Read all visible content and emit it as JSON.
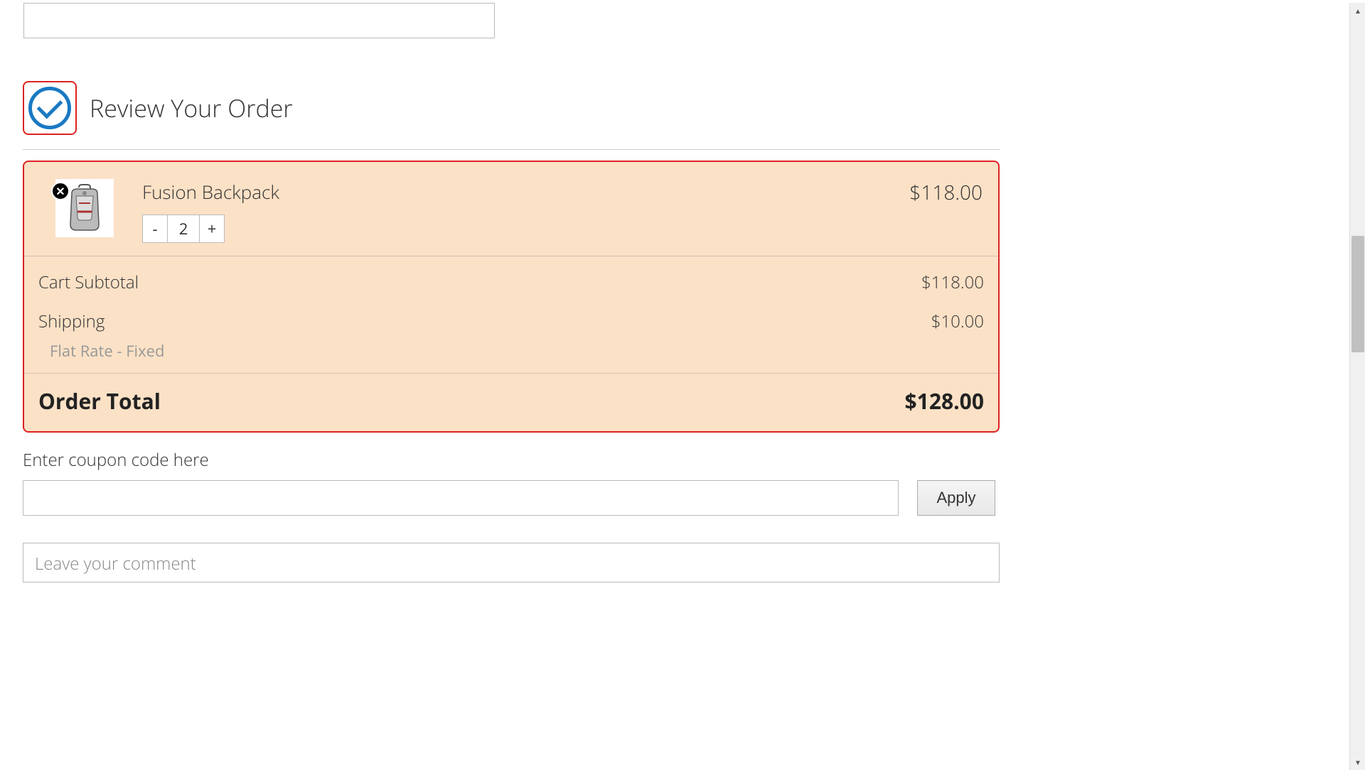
{
  "review": {
    "title": "Review Your Order",
    "item": {
      "name": "Fusion Backpack",
      "quantity": "2",
      "price": "$118.00",
      "decrement": "-",
      "increment": "+"
    },
    "subtotal": {
      "label": "Cart Subtotal",
      "value": "$118.00"
    },
    "shipping": {
      "label": "Shipping",
      "value": "$10.00",
      "method": "Flat Rate - Fixed"
    },
    "total": {
      "label": "Order Total",
      "value": "$128.00"
    }
  },
  "coupon": {
    "label": "Enter coupon code here",
    "apply": "Apply"
  },
  "comment": {
    "placeholder": "Leave your comment"
  }
}
